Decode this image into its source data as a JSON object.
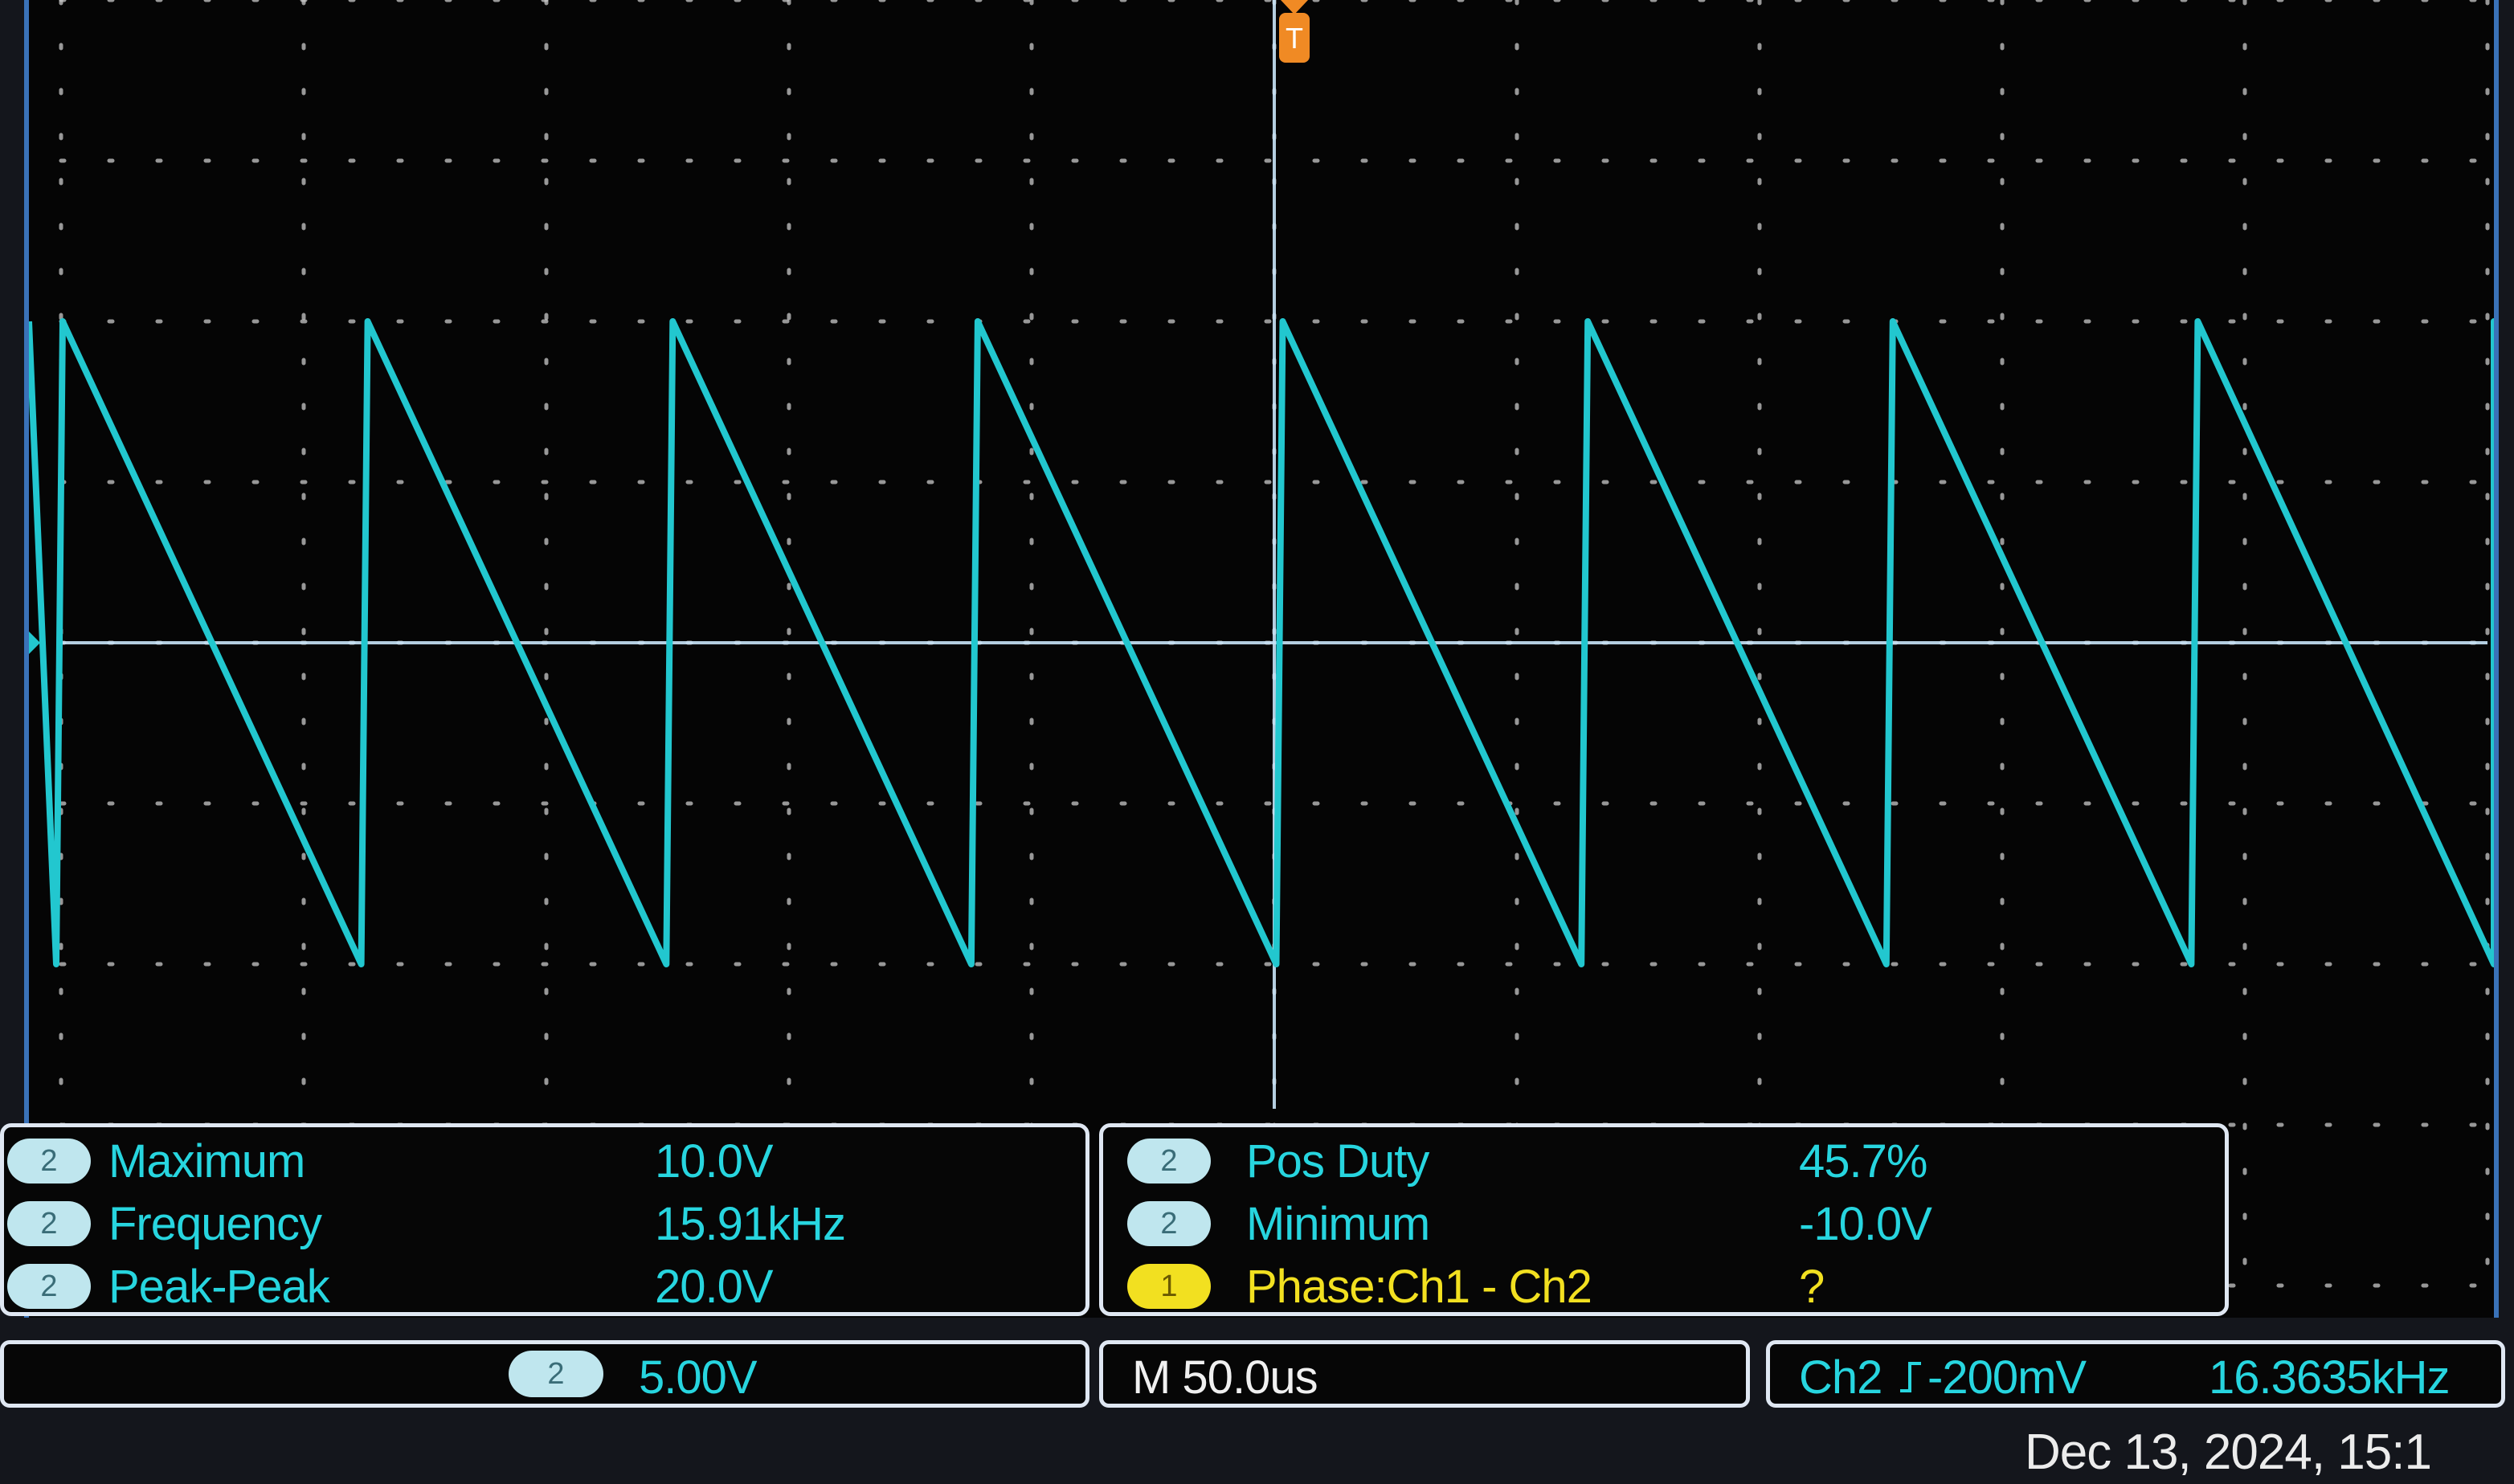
{
  "colors": {
    "trace": "#22c7cf",
    "grid": "#c9c9c9",
    "cursor": "#c8e4f8",
    "trigger": "#f08a24",
    "panel_border": "#dfe7f2",
    "measure_text": "#27d5df",
    "phase_text": "#f2e020"
  },
  "waveform": {
    "channel": "2",
    "shape": "sawtooth-falling",
    "frequency_khz": 15.91,
    "max_v": 10.0,
    "min_v": -10.0,
    "volts_per_div": 5.0,
    "time_per_div_us": 50.0,
    "cycles_visible": 8
  },
  "measurements": {
    "left": [
      {
        "ch": "2",
        "label": "Maximum",
        "value": "10.0V"
      },
      {
        "ch": "2",
        "label": "Frequency",
        "value": "15.91kHz"
      },
      {
        "ch": "2",
        "label": "Peak-Peak",
        "value": "20.0V"
      }
    ],
    "right": [
      {
        "ch": "2",
        "label": "Pos Duty",
        "value": "45.7%"
      },
      {
        "ch": "2",
        "label": "Minimum",
        "value": "-10.0V"
      },
      {
        "ch": "1",
        "label": "Phase:Ch1 - Ch2",
        "value": "?"
      }
    ]
  },
  "status": {
    "scale_channel": "2",
    "scale_value": "5.00V",
    "timebase": "M 50.0us",
    "trigger_source": "Ch2",
    "trigger_slope_icon": "rising-edge-icon",
    "trigger_level": "-200mV",
    "trigger_frequency": "16.3635kHz"
  },
  "datetime": "Dec 13, 2024, 15:1"
}
